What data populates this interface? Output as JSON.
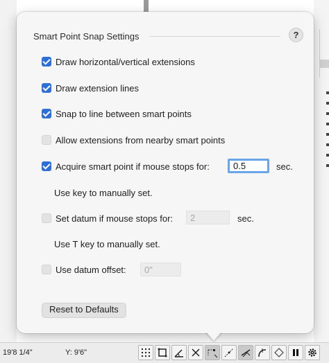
{
  "popover": {
    "title": "Smart Point Snap Settings",
    "help_label": "?",
    "options": [
      {
        "label": "Draw horizontal/vertical extensions",
        "checked": true,
        "enabled": true
      },
      {
        "label": "Draw extension lines",
        "checked": true,
        "enabled": true
      },
      {
        "label": "Snap to line between smart points",
        "checked": true,
        "enabled": true
      },
      {
        "label": "Allow extensions from nearby smart points",
        "checked": false,
        "enabled": false
      },
      {
        "label": "Acquire smart point if mouse stops for:",
        "checked": true,
        "enabled": true
      },
      {
        "label": "Set datum if mouse stops for:",
        "checked": false,
        "enabled": false
      },
      {
        "label": "Use datum offset:",
        "checked": false,
        "enabled": false
      }
    ],
    "acquire_value": "0.5",
    "acquire_unit": "sec.",
    "acquire_hint": "Use  key to manually set.",
    "datum_value": "2",
    "datum_unit": "sec.",
    "datum_hint": "Use T key to manually set.",
    "offset_value": "0\"",
    "reset_label": "Reset to Defaults"
  },
  "statusbar": {
    "x_readout": "19'8 1/4\"",
    "y_readout": "Y: 9'6\"",
    "tools": [
      "snap-grid-icon",
      "snap-object-icon",
      "snap-angle-icon",
      "snap-intersection-icon",
      "smart-points-icon",
      "snap-distance-icon",
      "snap-tangent-icon",
      "snap-surface-icon",
      "diamond-icon",
      "pause-icon",
      "gear-icon"
    ]
  },
  "colors": {
    "accent": "#2d6fd7",
    "focus_ring": "#6aa5ea",
    "popover_bg": "#f6f6f6"
  }
}
